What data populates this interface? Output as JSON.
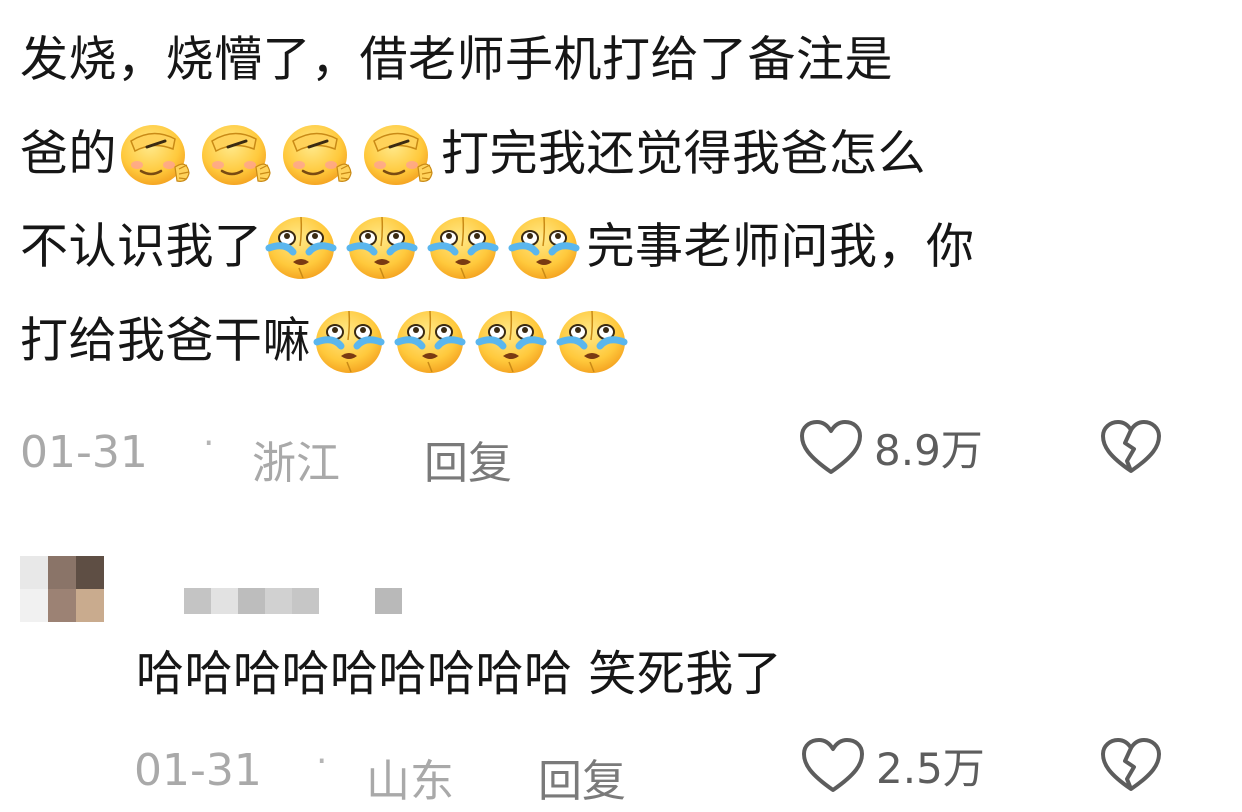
{
  "comment1": {
    "line1": "发烧，烧懵了，借老师手机打给了备注是",
    "line2_pre": "爸的",
    "line2_post": "打完我还觉得我爸怎么",
    "line3_pre": "不认识我了",
    "line3_post": "完事老师问我，你",
    "line4_pre": "打给我爸干嘛",
    "emoji_facepalm": "facepalm-emoji",
    "emoji_crying": "crying-emoji",
    "date": "01-31",
    "separator": "·",
    "location": "浙江",
    "reply_label": "回复",
    "likes": "8.9万"
  },
  "reply1": {
    "text": "哈哈哈哈哈哈哈哈哈 笑死我了",
    "date": "01-31",
    "separator": "·",
    "location": "山东",
    "reply_label": "回复",
    "likes": "2.5万"
  },
  "colors": {
    "text": "#161616",
    "meta": "#a9a9a9",
    "reply": "#7a7a7a",
    "icon": "#5d5d5d"
  }
}
